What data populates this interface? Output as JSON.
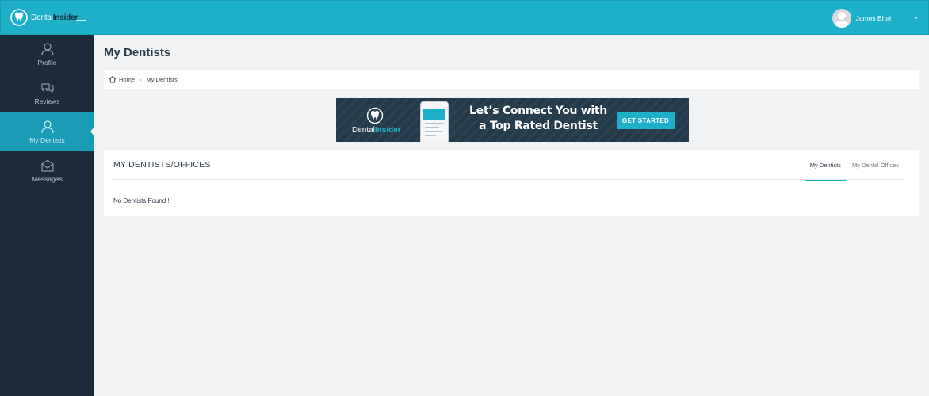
{
  "topbar": {
    "logo": {
      "part1": "Dental",
      "part2": "Insider"
    },
    "user": {
      "name": "James Bhai"
    },
    "accent": "#1fb0c9"
  },
  "sidebar": {
    "items": [
      {
        "label": "Profile",
        "icon": "user-icon",
        "active": false
      },
      {
        "label": "Reviews",
        "icon": "chat-bubbles-icon",
        "active": false
      },
      {
        "label": "My Dentists",
        "icon": "dentist-user-icon",
        "active": true
      },
      {
        "label": "Messages",
        "icon": "envelope-icon",
        "active": false
      }
    ],
    "background": "#1d2b3a"
  },
  "main": {
    "page_title": "My Dentists",
    "breadcrumb": {
      "home": "Home",
      "current": "My Dentists"
    },
    "banner": {
      "logo_part1": "Dental",
      "logo_part2": "Insider",
      "headline_line1": "Let’s Connect You with",
      "headline_line2": "a Top Rated Dentist",
      "cta": "GET STARTED"
    },
    "panel": {
      "title": "MY DENTISTS/OFFICES",
      "tabs": [
        {
          "label": "My Dentists",
          "active": true
        },
        {
          "label": "My Dental Offices",
          "active": false
        }
      ],
      "empty_message": "No Dentists Found !"
    }
  }
}
